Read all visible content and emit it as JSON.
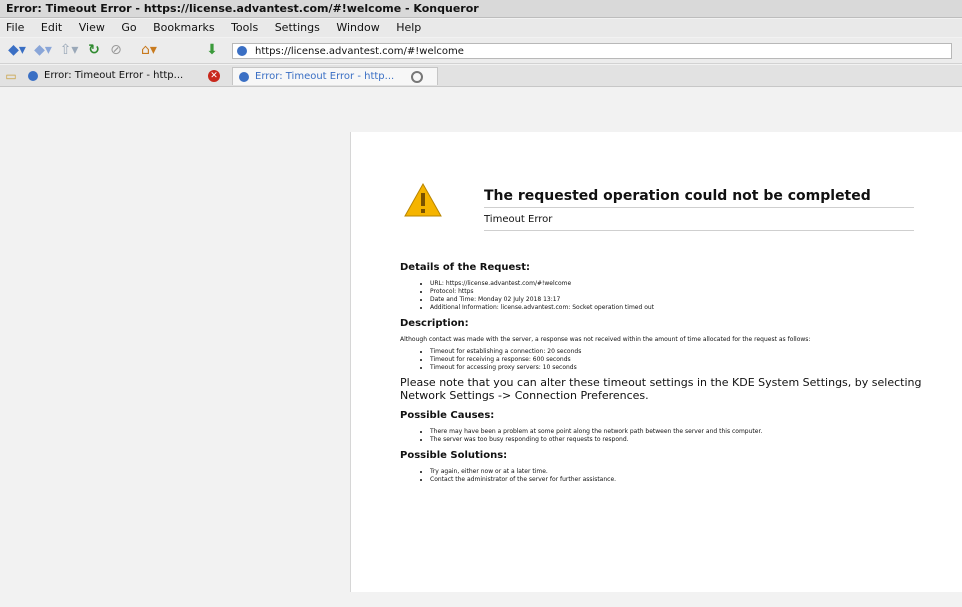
{
  "window": {
    "title": "Error: Timeout Error - https://license.advantest.com/#!welcome - Konqueror"
  },
  "menu": [
    "File",
    "Edit",
    "View",
    "Go",
    "Bookmarks",
    "Tools",
    "Settings",
    "Window",
    "Help"
  ],
  "toolbar": {
    "url": "https://license.advantest.com/#!welcome"
  },
  "tabs": [
    {
      "label": "Error: Timeout Error - http..."
    },
    {
      "label": "Error: Timeout Error - http..."
    }
  ],
  "error": {
    "title": "The requested operation could not be completed",
    "subtitle": "Timeout Error",
    "details_heading": "Details of the Request:",
    "details": [
      "URL: https://license.advantest.com/#!welcome",
      "Protocol: https",
      "Date and Time: Monday 02 July 2018 13:17",
      "Additional Information: license.advantest.com: Socket operation timed out"
    ],
    "description_heading": "Description:",
    "description": "Although contact was made with the server, a response was not received within the amount of time allocated for the request as follows:",
    "timeouts": [
      "Timeout for establishing a connection: 20 seconds",
      "Timeout for receiving a response: 600 seconds",
      "Timeout for accessing proxy servers: 10 seconds"
    ],
    "note": "Please note that you can alter these timeout settings in the KDE System Settings, by selecting Network Settings -> Connection Preferences.",
    "causes_heading": "Possible Causes:",
    "causes": [
      "There may have been a problem at some point along the network path between the server and this computer.",
      "The server was too busy responding to other requests to respond."
    ],
    "solutions_heading": "Possible Solutions:",
    "solutions": [
      "Try again, either now or at a later time.",
      "Contact the administrator of the server for further assistance."
    ]
  },
  "colors": {
    "warning": "#f5b400",
    "accent": "#3a6fc4",
    "close": "#c8281c"
  }
}
